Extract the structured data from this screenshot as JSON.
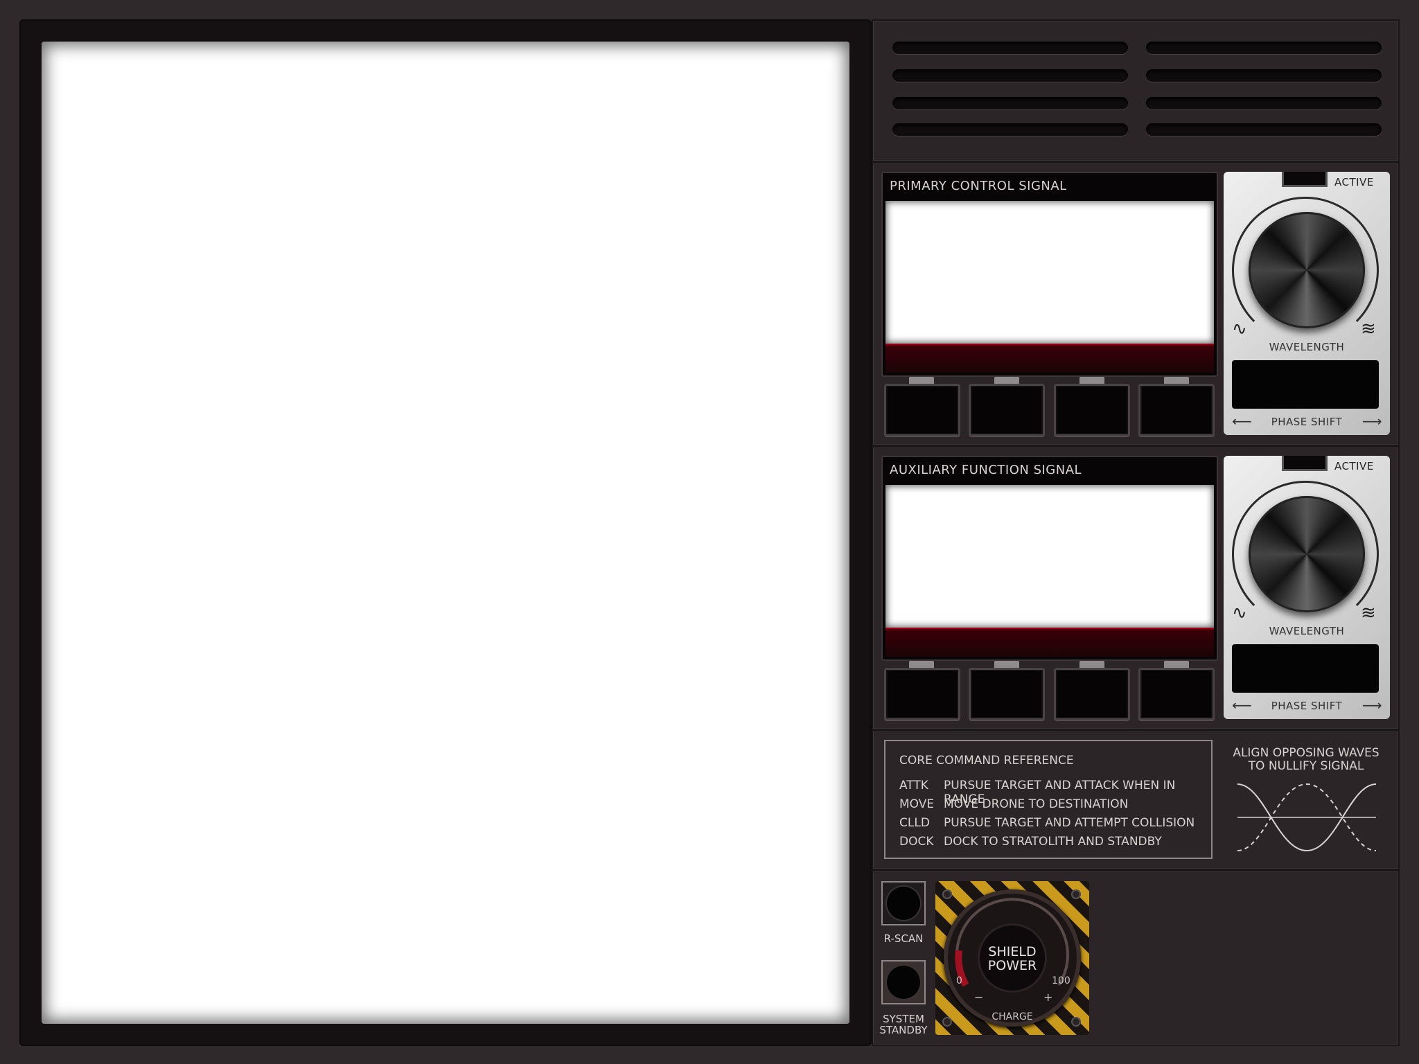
{
  "primary": {
    "title": "PRIMARY CONTROL SIGNAL",
    "active_label": "ACTIVE",
    "knob_label": "WAVELENGTH",
    "phase_label": "PHASE SHIFT"
  },
  "auxiliary": {
    "title": "AUXILIARY FUNCTION SIGNAL",
    "active_label": "ACTIVE",
    "knob_label": "WAVELENGTH",
    "phase_label": "PHASE SHIFT"
  },
  "reference": {
    "title": "CORE COMMAND REFERENCE",
    "commands": [
      {
        "code": "ATTK",
        "desc": "PURSUE TARGET AND ATTACK WHEN IN RANGE"
      },
      {
        "code": "MOVE",
        "desc": "MOVE DRONE TO DESTINATION"
      },
      {
        "code": "CLLD",
        "desc": "PURSUE TARGET AND ATTEMPT COLLISION"
      },
      {
        "code": "DOCK",
        "desc": "DOCK TO STRATOLITH AND STANDBY"
      }
    ]
  },
  "hint": {
    "line1": "ALIGN OPPOSING WAVES",
    "line2": "TO NULLIFY SIGNAL"
  },
  "controls": {
    "rscan_label": "R-SCAN",
    "standby_line1": "SYSTEM",
    "standby_line2": "STANDBY"
  },
  "shield": {
    "line1": "SHIELD",
    "line2": "POWER",
    "min": "0",
    "max": "100",
    "minus": "−",
    "plus": "+",
    "charge_label": "CHARGE"
  },
  "icons": {
    "left_arrow": "⟵",
    "right_arrow": "⟶",
    "low_wave": "∿",
    "high_wave": "≋"
  }
}
